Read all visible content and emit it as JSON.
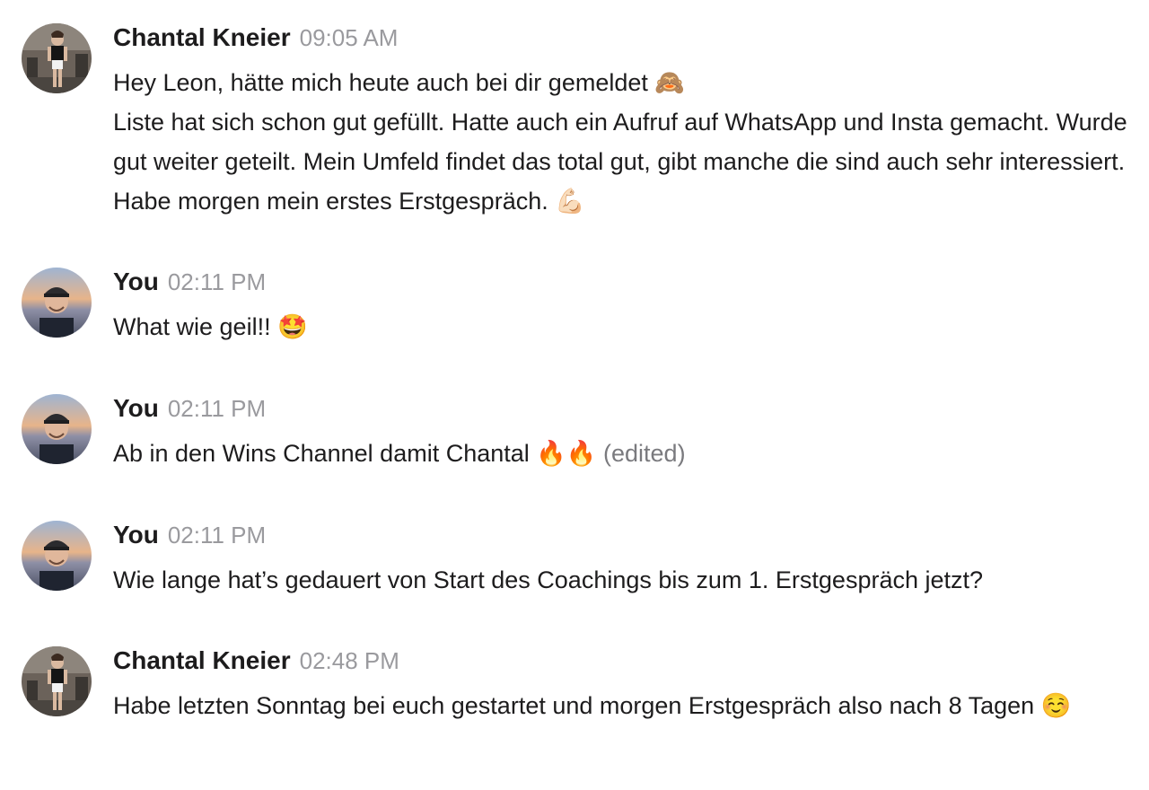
{
  "messages": [
    {
      "author": "Chantal Kneier",
      "time": "09:05 AM",
      "avatar": "chantal-avatar",
      "lines": [
        "Hey Leon, hätte mich heute auch bei dir gemeldet 🙈",
        "Liste hat sich schon gut gefüllt. Hatte auch ein Aufruf auf WhatsApp und Insta gemacht. Wurde gut weiter geteilt. Mein Umfeld findet das total gut, gibt manche die sind auch sehr interessiert. Habe morgen mein erstes Erstgespräch. 💪🏻"
      ]
    },
    {
      "author": "You",
      "time": "02:11 PM",
      "avatar": "you-avatar",
      "lines": [
        "What wie geil!! 🤩"
      ]
    },
    {
      "author": "You",
      "time": "02:11 PM",
      "avatar": "you-avatar",
      "lines": [
        "Ab in den Wins Channel damit Chantal 🔥🔥"
      ],
      "edited": "(edited)"
    },
    {
      "author": "You",
      "time": "02:11 PM",
      "avatar": "you-avatar",
      "lines": [
        "Wie lange hat’s gedauert von Start des Coachings bis zum 1. Erstgespräch jetzt?"
      ]
    },
    {
      "author": "Chantal Kneier",
      "time": "02:48 PM",
      "avatar": "chantal-avatar",
      "lines": [
        "Habe letzten Sonntag bei euch gestartet und morgen Erstgespräch also nach 8 Tagen ☺️"
      ]
    }
  ]
}
